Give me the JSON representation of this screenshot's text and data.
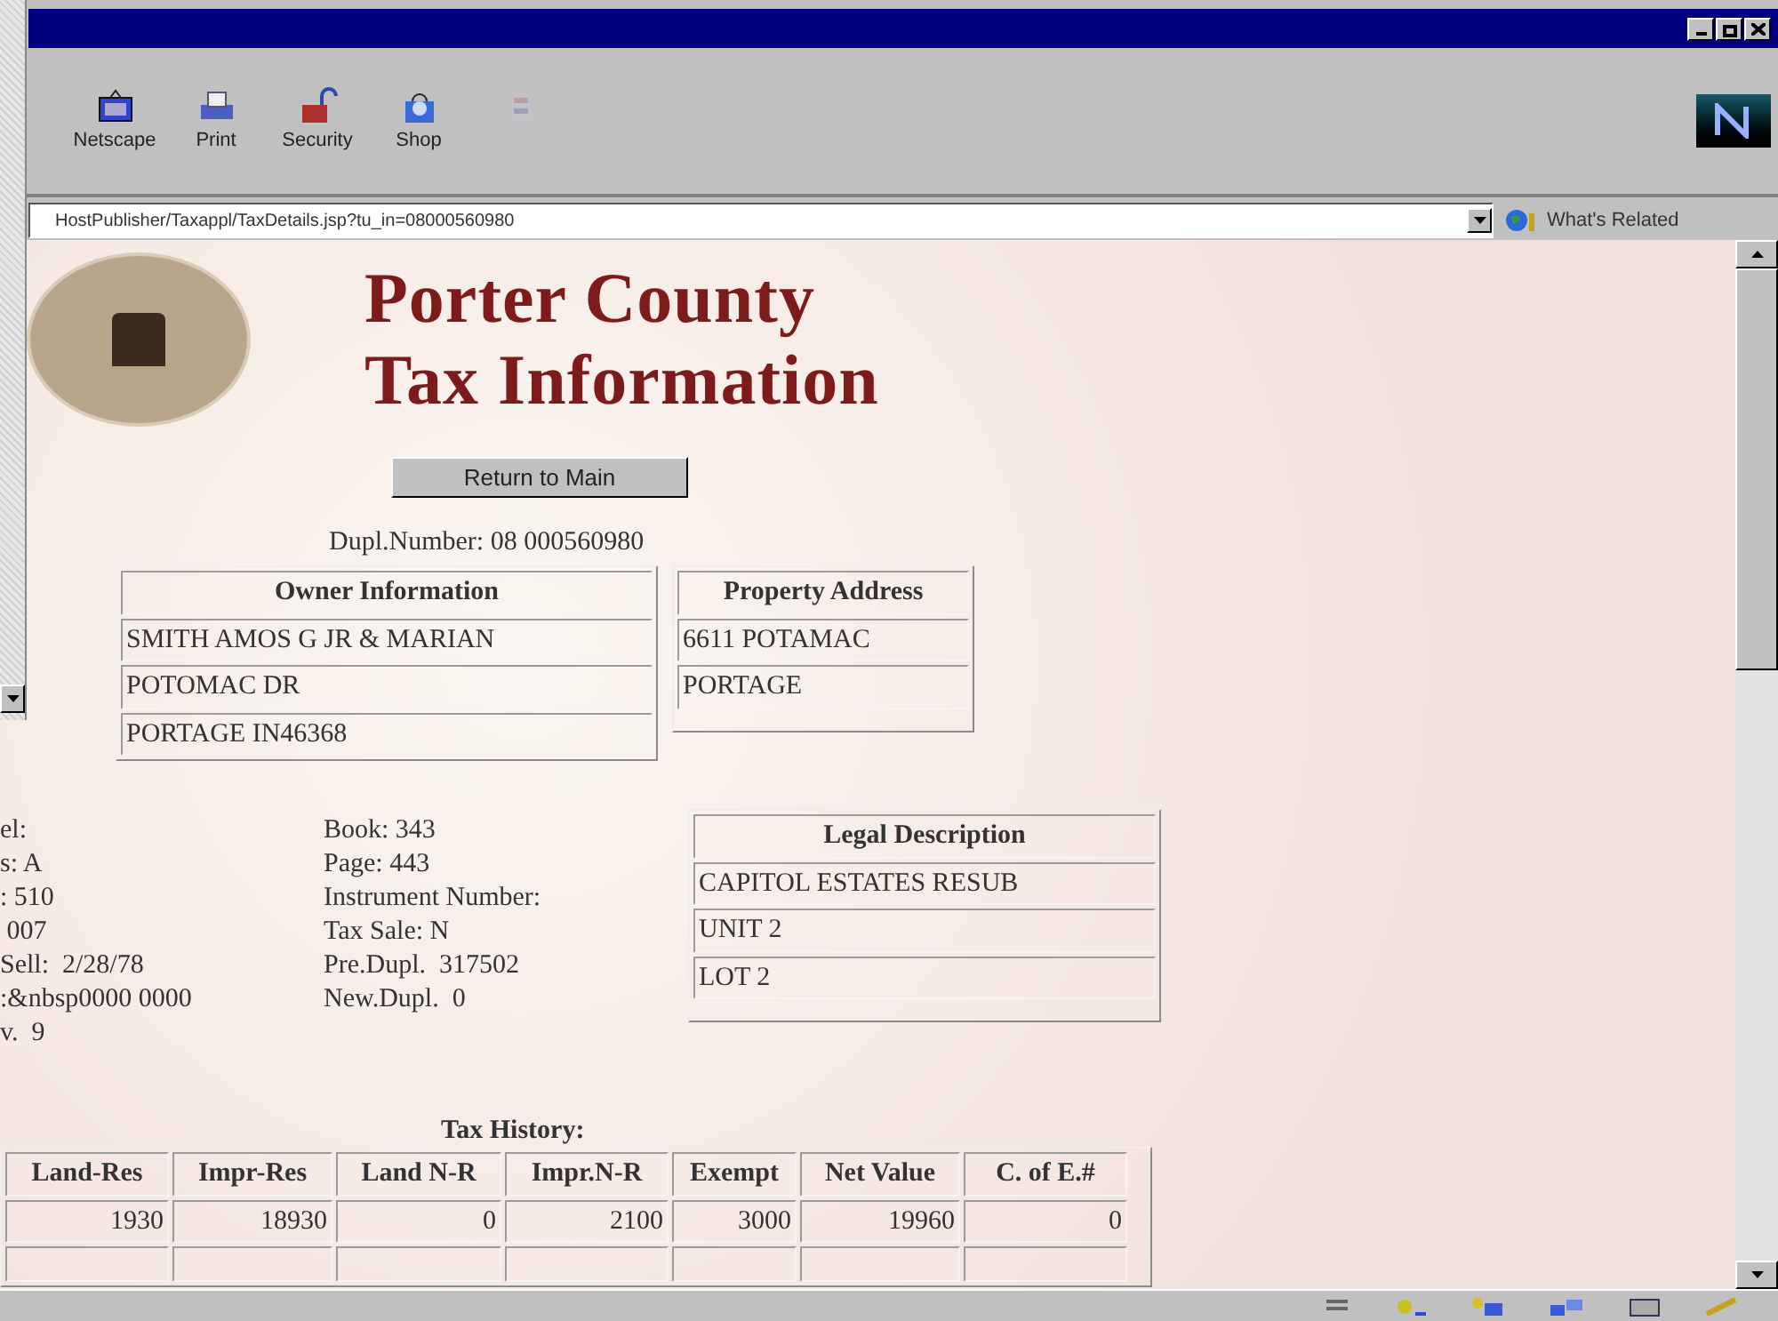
{
  "toolbar": {
    "items": [
      {
        "label": "Netscape",
        "kind": "netscape",
        "disabled": false
      },
      {
        "label": "Print",
        "kind": "print",
        "disabled": false
      },
      {
        "label": "Security",
        "kind": "security",
        "disabled": false
      },
      {
        "label": "Shop",
        "kind": "shop",
        "disabled": false
      },
      {
        "kind": "stop",
        "disabled": true
      }
    ]
  },
  "location": {
    "url": "HostPublisher/Taxappl/TaxDetails.jsp?tu_in=08000560980",
    "related": "What's Related"
  },
  "page": {
    "title_lines": [
      "Porter County",
      "Tax Information"
    ],
    "return_button": "Return to Main",
    "dupl_number": "Dupl.Number: 08 000560980",
    "owner_table": {
      "heading": "Owner Information",
      "rows": [
        "SMITH AMOS G JR & MARIAN",
        "POTOMAC DR",
        "PORTAGE IN46368"
      ]
    },
    "property_table": {
      "heading": "Property Address",
      "rows": [
        "6611 POTAMAC",
        "PORTAGE"
      ]
    },
    "left_fields": [
      "el:",
      "s: A",
      ": 510",
      " 007",
      "Sell:  2/28/78",
      ":&nbsp0000 0000",
      "v.  9"
    ],
    "middle_fields": [
      "Book: 343",
      "Page: 443",
      "Instrument Number:",
      "Tax Sale: N",
      "Pre.Dupl.  317502",
      "New.Dupl.  0"
    ],
    "legal_table": {
      "heading": "Legal Description",
      "rows": [
        "CAPITOL ESTATES RESUB",
        "UNIT 2",
        "LOT 2"
      ]
    },
    "tax_history": {
      "title": "Tax History:",
      "columns": [
        "Land-Res",
        "Impr-Res",
        "Land N-R",
        "Impr.N-R",
        "Exempt",
        "Net Value",
        "C. of E.#"
      ],
      "rows": [
        [
          "1930",
          "18930",
          "0",
          "2100",
          "3000",
          "19960",
          "0"
        ]
      ]
    }
  }
}
